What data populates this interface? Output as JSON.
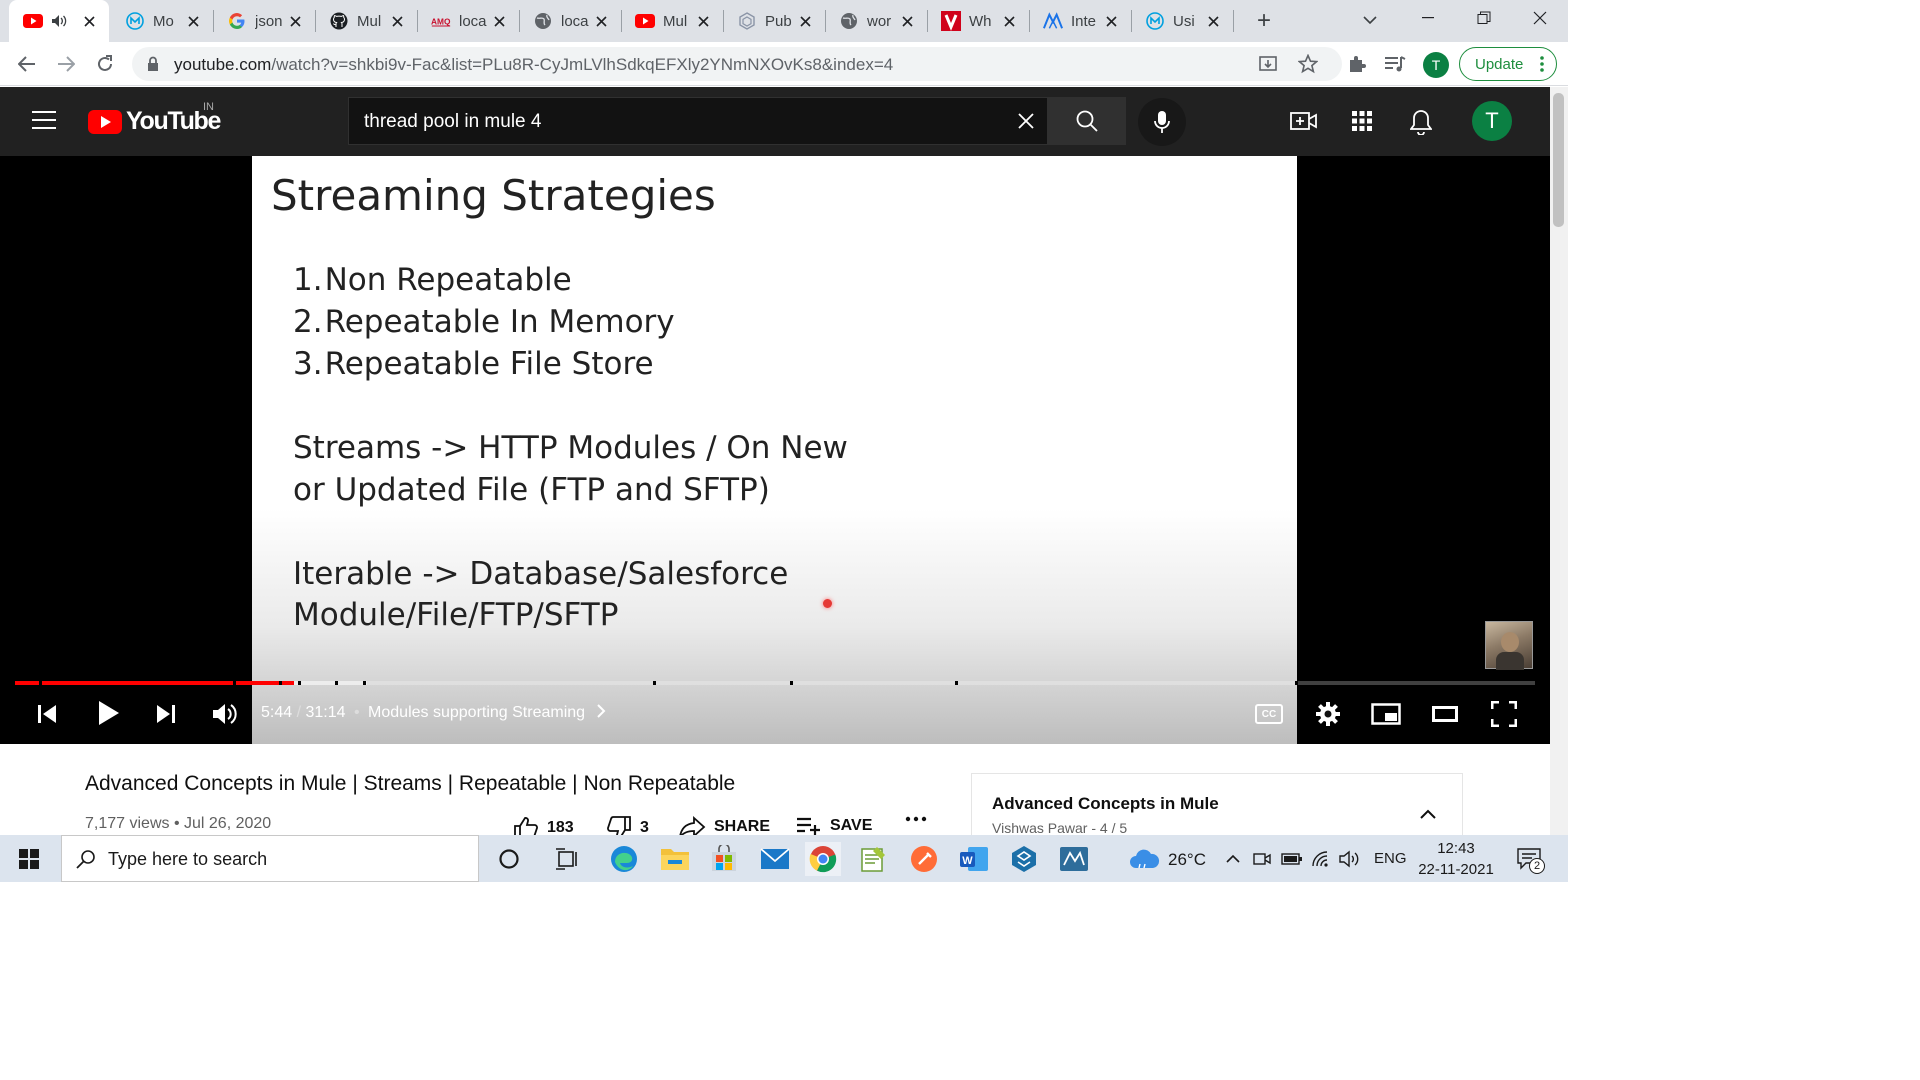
{
  "browser": {
    "tabs": [
      {
        "title": "",
        "icon": "youtube-icon",
        "audio": true,
        "active": true
      },
      {
        "title": "Mo",
        "icon": "mulesoft-icon"
      },
      {
        "title": "json",
        "icon": "google-icon"
      },
      {
        "title": "Mul",
        "icon": "github-icon"
      },
      {
        "title": "loca",
        "icon": "amq-icon",
        "icon_text": "AMQ"
      },
      {
        "title": "loca",
        "icon": "globe-icon"
      },
      {
        "title": "Mul",
        "icon": "youtube-icon"
      },
      {
        "title": "Pub",
        "icon": "hex-icon"
      },
      {
        "title": "wor",
        "icon": "globe-icon"
      },
      {
        "title": "Wh",
        "icon": "v-brand-icon",
        "icon_text": "V"
      },
      {
        "title": "Inte",
        "icon": "mule-m-icon"
      },
      {
        "title": "Usi",
        "icon": "mulesoft-icon"
      }
    ],
    "new_tab": "+",
    "url_host": "youtube.com",
    "url_path": "/watch?v=shkbi9v-Fac&list=PLu8R-CyJmLVlhSdkqEFXly2YNmNXOvKs8&index=4",
    "profile_initial": "T",
    "update_label": "Update"
  },
  "youtube": {
    "logo_text": "YouTube",
    "region": "IN",
    "search_query": "thread pool in mule 4",
    "avatar_initial": "T"
  },
  "slide": {
    "title": "Streaming Strategies",
    "list": [
      {
        "num": "1.",
        "text": "Non Repeatable"
      },
      {
        "num": "2.",
        "text": "Repeatable In Memory"
      },
      {
        "num": "3.",
        "text": "Repeatable File Store"
      }
    ],
    "streams_line1": "Streams -> HTTP Modules / On New",
    "streams_line2": "or Updated File (FTP and SFTP)",
    "iterable_line1": "Iterable -> Database/Salesforce",
    "iterable_line2": "Module/File/FTP/SFTP"
  },
  "player": {
    "current_time": "5:44",
    "duration": "31:14",
    "separator": "•",
    "chapter": "Modules supporting Streaming",
    "played_fraction": 0.1836,
    "buffered_fraction": 0.2315,
    "cc_label": "CC"
  },
  "video": {
    "title": "Advanced Concepts in Mule | Streams | Repeatable | Non Repeatable",
    "views": "7,177 views",
    "date": "Jul 26, 2020",
    "likes": "183",
    "dislikes": "3",
    "share_label": "SHARE",
    "save_label": "SAVE"
  },
  "playlist": {
    "title": "Advanced Concepts in Mule",
    "meta": "Vishwas Pawar - 4 / 5"
  },
  "taskbar": {
    "search_placeholder": "Type here to search",
    "temperature": "26°C",
    "language": "ENG",
    "time": "12:43",
    "date": "22-11-2021",
    "notification_count": "2"
  },
  "colors": {
    "youtube_red": "#ff0000",
    "progress_red": "#ff0000",
    "avatar_green": "#0b8043",
    "chrome_bg": "#dee1e6"
  }
}
